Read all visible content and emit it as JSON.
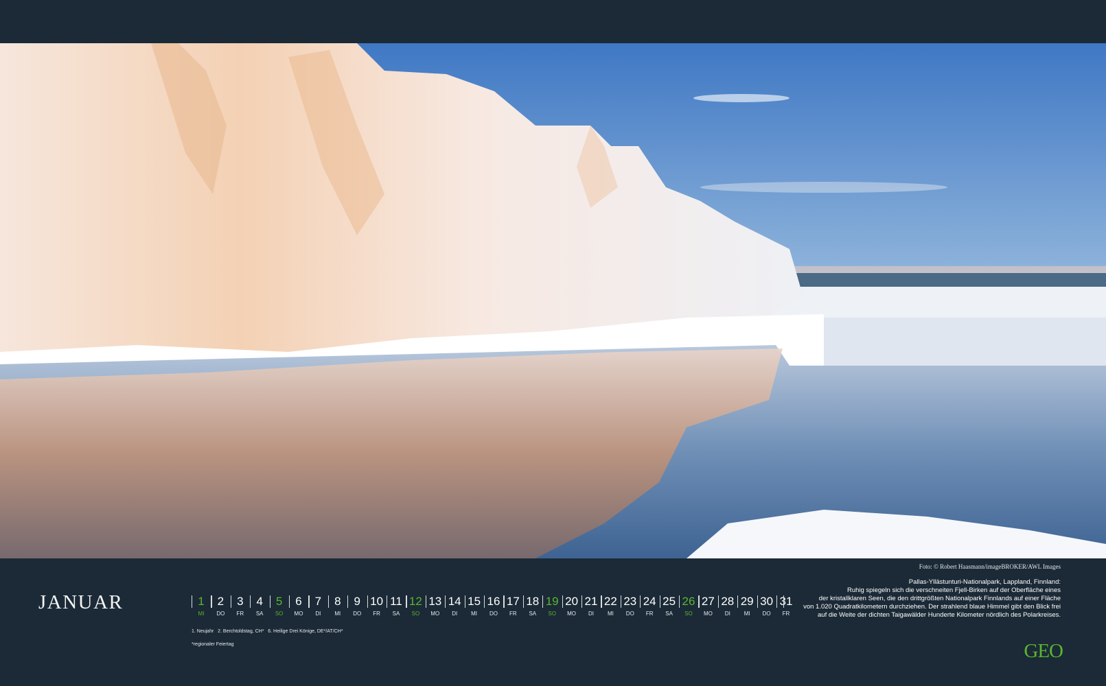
{
  "photo": {
    "credit": "Foto: © Robert Haasmann/imageBROKER/AWL Images"
  },
  "calendar": {
    "month": "JANUAR",
    "days": [
      {
        "n": "1",
        "wd": "MI",
        "type": "hol"
      },
      {
        "n": "2",
        "wd": "DO",
        "type": ""
      },
      {
        "n": "3",
        "wd": "FR",
        "type": ""
      },
      {
        "n": "4",
        "wd": "SA",
        "type": ""
      },
      {
        "n": "5",
        "wd": "SO",
        "type": "sun"
      },
      {
        "n": "6",
        "wd": "MO",
        "type": ""
      },
      {
        "n": "7",
        "wd": "DI",
        "type": ""
      },
      {
        "n": "8",
        "wd": "MI",
        "type": ""
      },
      {
        "n": "9",
        "wd": "DO",
        "type": ""
      },
      {
        "n": "10",
        "wd": "FR",
        "type": ""
      },
      {
        "n": "11",
        "wd": "SA",
        "type": ""
      },
      {
        "n": "12",
        "wd": "SO",
        "type": "sun"
      },
      {
        "n": "13",
        "wd": "MO",
        "type": ""
      },
      {
        "n": "14",
        "wd": "DI",
        "type": ""
      },
      {
        "n": "15",
        "wd": "MI",
        "type": ""
      },
      {
        "n": "16",
        "wd": "DO",
        "type": ""
      },
      {
        "n": "17",
        "wd": "FR",
        "type": ""
      },
      {
        "n": "18",
        "wd": "SA",
        "type": ""
      },
      {
        "n": "19",
        "wd": "SO",
        "type": "sun"
      },
      {
        "n": "20",
        "wd": "MO",
        "type": ""
      },
      {
        "n": "21",
        "wd": "DI",
        "type": ""
      },
      {
        "n": "22",
        "wd": "MI",
        "type": ""
      },
      {
        "n": "23",
        "wd": "DO",
        "type": ""
      },
      {
        "n": "24",
        "wd": "FR",
        "type": ""
      },
      {
        "n": "25",
        "wd": "SA",
        "type": ""
      },
      {
        "n": "26",
        "wd": "SO",
        "type": "sun"
      },
      {
        "n": "27",
        "wd": "MO",
        "type": ""
      },
      {
        "n": "28",
        "wd": "DI",
        "type": ""
      },
      {
        "n": "29",
        "wd": "MI",
        "type": ""
      },
      {
        "n": "30",
        "wd": "DO",
        "type": ""
      },
      {
        "n": "31",
        "wd": "FR",
        "type": ""
      }
    ],
    "holidays": "1. Neujahr   2. Berchtoldstag, CH*   6. Heilige Drei Könige, DE*/AT/CH*",
    "regional_note": "*regionaler Feiertag"
  },
  "caption": {
    "title": "Pallas-Yllästunturi-Nationalpark, Lappland, Finnland:",
    "lines": [
      "Ruhig spiegeln sich die verschneiten Fjell-Birken auf der Oberfläche eines",
      "der kristallklaren Seen, die den drittgrößten Nationalpark Finnlands auf einer Fläche",
      "von 1.020 Quadratkilometern durchziehen. Der strahlend blaue Himmel gibt den Blick frei",
      "auf die Weite der dichten Taigawälder Hunderte Kilometer nördlich des Polarkreises."
    ]
  },
  "brand": {
    "logo": "GEO"
  },
  "colors": {
    "background": "#1b2a36",
    "accent_green": "#5cb531"
  }
}
